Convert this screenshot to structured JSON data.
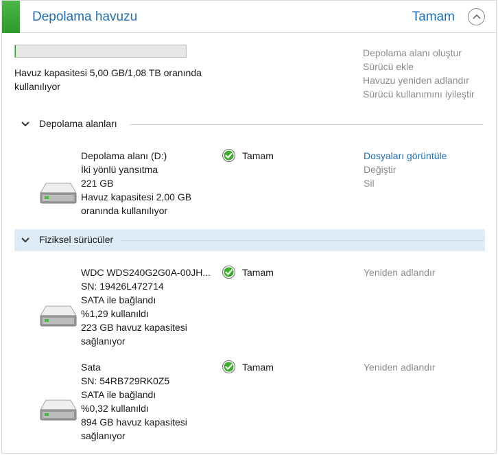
{
  "header": {
    "title": "Depolama havuzu",
    "status": "Tamam"
  },
  "capacity": {
    "usage_fraction": 0.0046,
    "text": "Havuz kapasitesi 5,00 GB/1,08 TB oranında kullanılıyor"
  },
  "pool_actions": [
    "Depolama alanı oluştur",
    "Sürücü ekle",
    "Havuzu yeniden adlandır",
    "Sürücü kullanımını iyileştir"
  ],
  "storage_section": {
    "label": "Depolama alanları",
    "items": [
      {
        "lines": [
          "Depolama alanı (D:)",
          "İki yönlü yansıtma",
          "221 GB",
          "Havuz kapasitesi 2,00 GB",
          "oranında kullanılıyor"
        ],
        "status": "Tamam",
        "actions": [
          "Dosyaları görüntüle",
          "Değiştir",
          "Sil"
        ]
      }
    ]
  },
  "physical_section": {
    "label": "Fiziksel sürücüler",
    "items": [
      {
        "lines": [
          "WDC WDS240G2G0A-00JH...",
          "SN: 19426L472714",
          "SATA ile bağlandı",
          "%1,29 kullanıldı",
          "223 GB havuz kapasitesi",
          "sağlanıyor"
        ],
        "status": "Tamam",
        "action": "Yeniden adlandır"
      },
      {
        "lines": [
          "Sata",
          "SN: 54RB729RK0Z5",
          "SATA ile bağlandı",
          "%0,32 kullanıldı",
          "894 GB havuz kapasitesi",
          "sağlanıyor"
        ],
        "status": "Tamam",
        "action": "Yeniden adlandır"
      }
    ]
  },
  "icons": {
    "collapse": "chevron-up-circle-icon",
    "section_toggle": "chevron-down-icon",
    "status_ok": "green-check-icon",
    "drive": "hard-drive-icon"
  },
  "colors": {
    "accent": "#3aa836",
    "link": "#1e6fb8",
    "disabled": "#8c8c8c",
    "highlight": "#deecf8"
  }
}
